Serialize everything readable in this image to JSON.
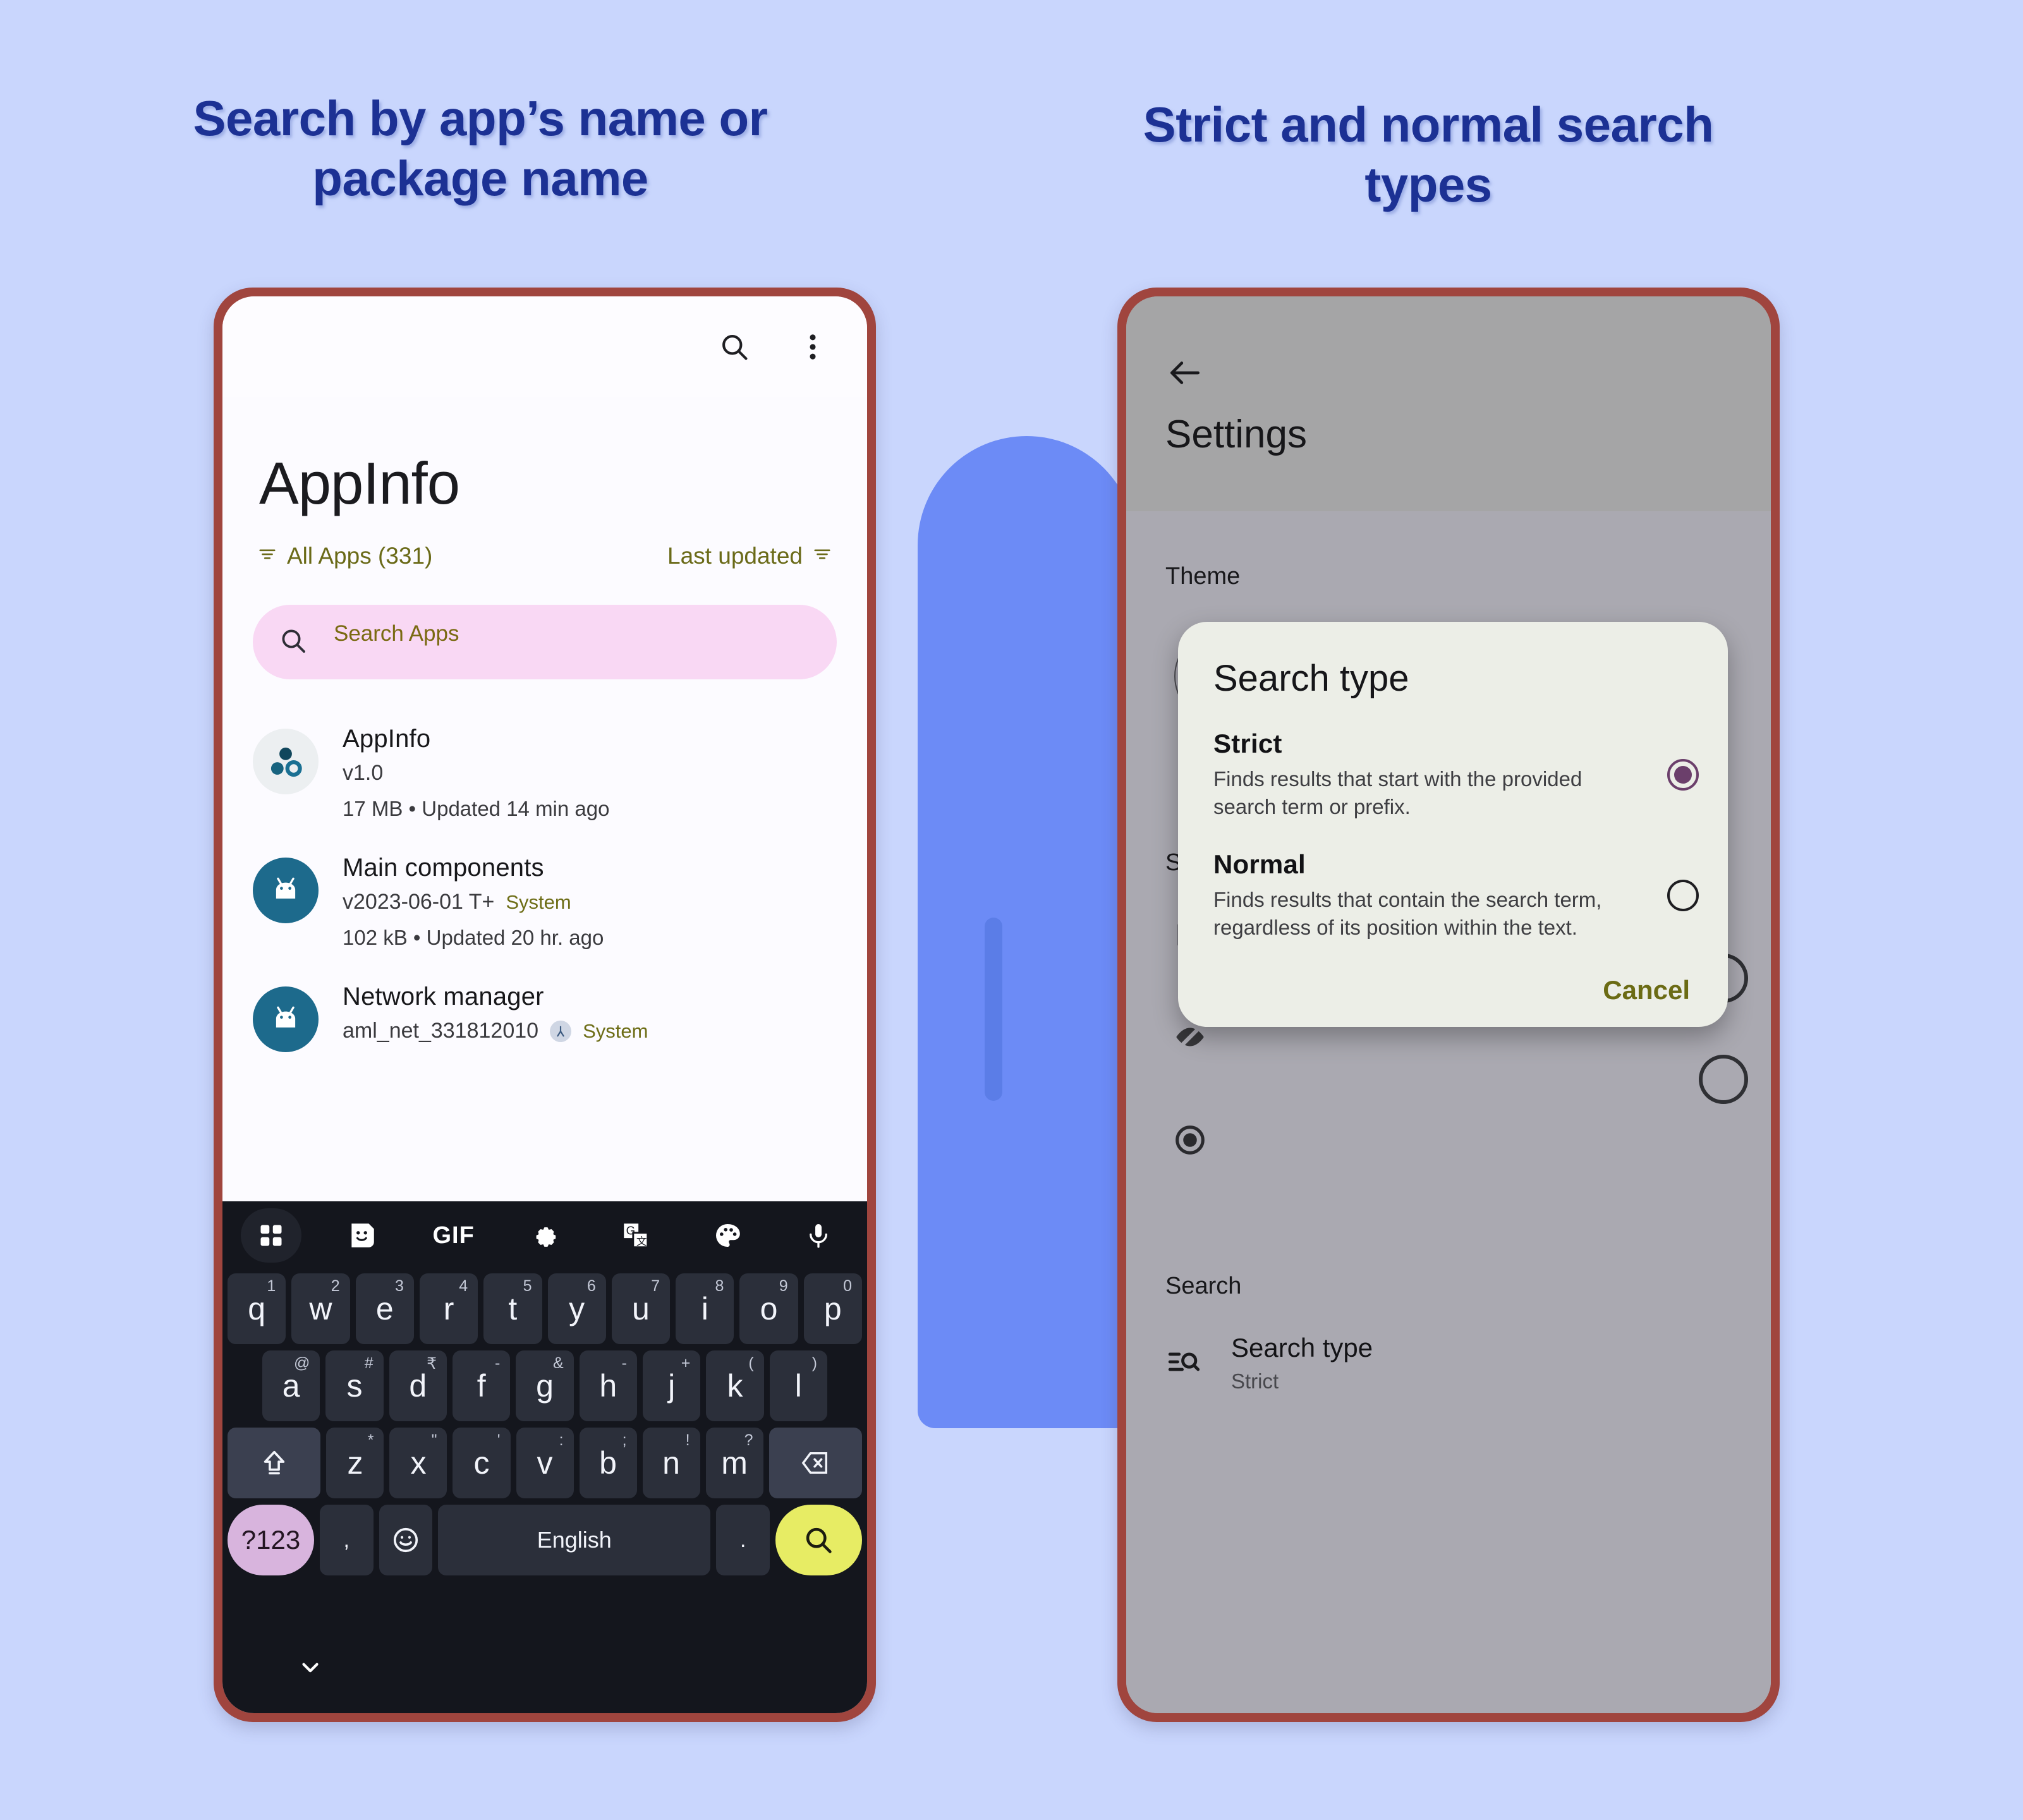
{
  "colors": {
    "page_background": "#c9d6fd",
    "headline": "#1c3194",
    "phone_frame": "#a0453e",
    "accent_blue": "#6c8bf6",
    "search_field": "#f9d8f4",
    "accent_olive": "#6a6a18",
    "keyboard_bg": "#14161d",
    "enter_key": "#e7ec64",
    "sym_key": "#d8b4dd",
    "dialog_bg": "#eceee7",
    "radio_selected": "#6b3f6b"
  },
  "headings": {
    "left": "Search by app’s name or package name",
    "right": "Strict and normal search types"
  },
  "left_phone": {
    "topbar": {
      "search_icon": "search-icon",
      "overflow_icon": "more-vert-icon"
    },
    "title": "AppInfo",
    "filter": {
      "left_label": "All Apps (331)",
      "right_label": "Last updated",
      "left_icon": "filter-icon",
      "right_icon": "sort-icon"
    },
    "search": {
      "placeholder": "Search Apps",
      "value": "",
      "icon": "search-icon"
    },
    "apps": [
      {
        "name": "AppInfo",
        "version": "v1.0",
        "system": "",
        "details": "17 MB • Updated 14 min ago",
        "icon": "appinfo-icon",
        "has_split_badge": false
      },
      {
        "name": "Main components",
        "version": "v2023-06-01 T+",
        "system": "System",
        "details": "102 kB • Updated 20 hr. ago",
        "icon": "android-icon",
        "has_split_badge": false
      },
      {
        "name": "Network manager",
        "version": "aml_net_331812010",
        "system": "System",
        "details": "",
        "icon": "android-icon",
        "has_split_badge": true
      }
    ],
    "keyboard": {
      "toolbar_icons": [
        "grid-apps-icon",
        "sticker-icon",
        "gif-icon",
        "gear-icon",
        "translate-icon",
        "palette-icon",
        "mic-icon"
      ],
      "gif_label": "GIF",
      "row1": [
        {
          "key": "q",
          "hint": "1"
        },
        {
          "key": "w",
          "hint": "2"
        },
        {
          "key": "e",
          "hint": "3"
        },
        {
          "key": "r",
          "hint": "4"
        },
        {
          "key": "t",
          "hint": "5"
        },
        {
          "key": "y",
          "hint": "6"
        },
        {
          "key": "u",
          "hint": "7"
        },
        {
          "key": "i",
          "hint": "8"
        },
        {
          "key": "o",
          "hint": "9"
        },
        {
          "key": "p",
          "hint": "0"
        }
      ],
      "row2": [
        {
          "key": "a",
          "hint": "@"
        },
        {
          "key": "s",
          "hint": "#"
        },
        {
          "key": "d",
          "hint": "₹"
        },
        {
          "key": "f",
          "hint": "-"
        },
        {
          "key": "g",
          "hint": "&"
        },
        {
          "key": "h",
          "hint": "-"
        },
        {
          "key": "j",
          "hint": "+"
        },
        {
          "key": "k",
          "hint": "("
        },
        {
          "key": "l",
          "hint": ")"
        }
      ],
      "row3": [
        {
          "key": "z",
          "hint": "*"
        },
        {
          "key": "x",
          "hint": "\""
        },
        {
          "key": "c",
          "hint": "'"
        },
        {
          "key": "v",
          "hint": ":"
        },
        {
          "key": "b",
          "hint": ";"
        },
        {
          "key": "n",
          "hint": "!"
        },
        {
          "key": "m",
          "hint": "?"
        }
      ],
      "shift_icon": "shift-icon",
      "backspace_icon": "backspace-icon",
      "sym_label": "?123",
      "comma_label": ",",
      "emoji_icon": "emoji-icon",
      "space_label": "English",
      "period_label": ".",
      "enter_icon": "search-icon",
      "chevron_icon": "chevron-down-icon"
    }
  },
  "right_phone": {
    "back_icon": "arrow-back-icon",
    "title": "Settings",
    "theme_label": "Theme",
    "theme_options": [
      {
        "name": "dark-theme",
        "icon": "moon-icon",
        "selected": false
      },
      {
        "name": "auto-theme",
        "icon": "auto-awesome-icon",
        "selected": false
      },
      {
        "name": "light-theme",
        "icon": "sun-icon",
        "selected": true
      }
    ],
    "scan_label": "Sca",
    "scan_icons": [
      "file-off-icon",
      "eye-off-icon",
      "target-icon"
    ],
    "search_section_label": "Search",
    "search_type_item": {
      "icon": "search-list-icon",
      "title": "Search type",
      "value": "Strict"
    },
    "dialog": {
      "title": "Search type",
      "options": [
        {
          "label": "Strict",
          "description": "Finds results that start with the provided search term or prefix.",
          "selected": true
        },
        {
          "label": "Normal",
          "description": "Finds results that contain the search term, regardless of its position within the text.",
          "selected": false
        }
      ],
      "cancel_label": "Cancel"
    }
  }
}
